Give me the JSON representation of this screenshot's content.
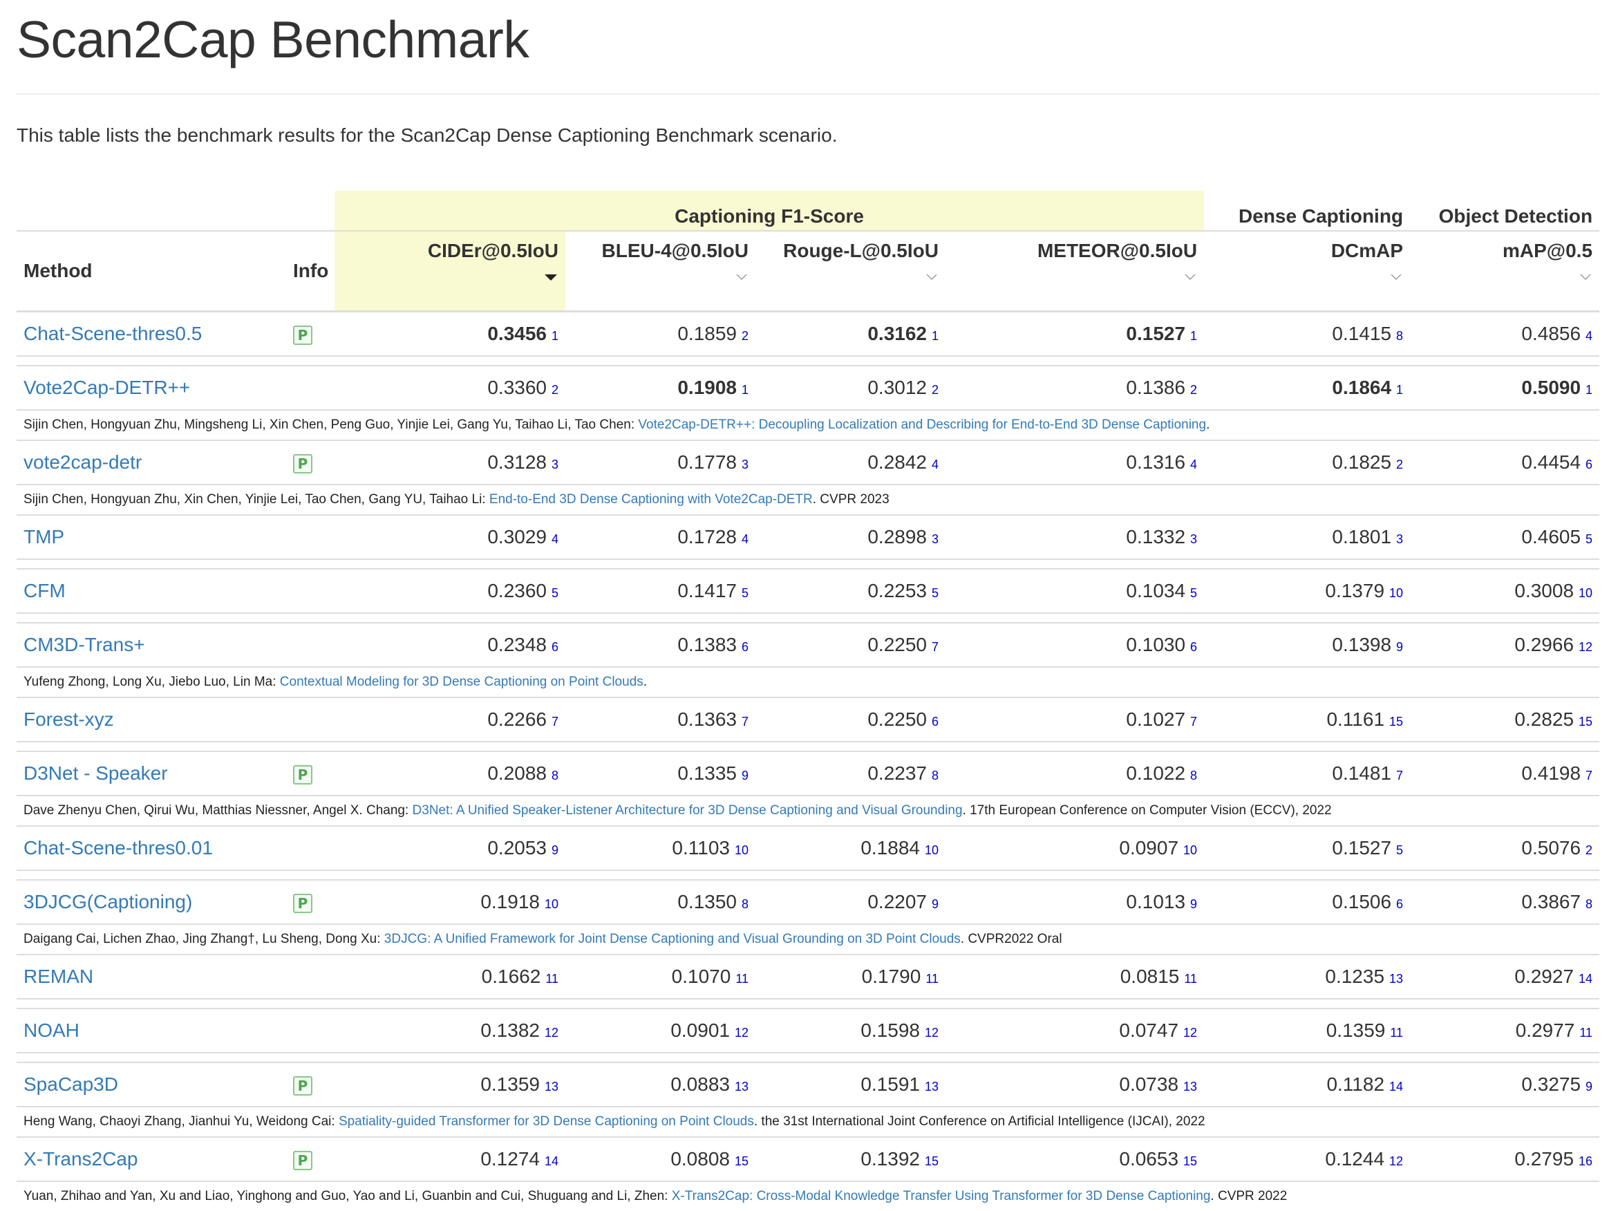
{
  "page": {
    "title": "Scan2Cap Benchmark",
    "intro": "This table lists the benchmark results for the Scan2Cap Dense Captioning Benchmark scenario."
  },
  "table": {
    "group_headers": {
      "captioning": "Captioning F1-Score",
      "dense": "Dense Captioning",
      "detection": "Object Detection"
    },
    "column_headers": {
      "method": "Method",
      "info": "Info",
      "cider": "CIDEr@0.5IoU",
      "bleu": "BLEU-4@0.5IoU",
      "rouge": "Rouge-L@0.5IoU",
      "meteor": "METEOR@0.5IoU",
      "dcmap": "DCmAP",
      "map": "mAP@0.5"
    },
    "sort": {
      "active_column": "cider",
      "direction": "descending"
    },
    "info_badge": "P",
    "rows": [
      {
        "method": "Chat-Scene-thres0.5",
        "info": "P",
        "cider": {
          "v": "0.3456",
          "r": "1",
          "best": true
        },
        "bleu": {
          "v": "0.1859",
          "r": "2",
          "best": false
        },
        "rouge": {
          "v": "0.3162",
          "r": "1",
          "best": true
        },
        "meteor": {
          "v": "0.1527",
          "r": "1",
          "best": true
        },
        "dcmap": {
          "v": "0.1415",
          "r": "8",
          "best": false
        },
        "map": {
          "v": "0.4856",
          "r": "4",
          "best": false
        },
        "cite": null
      },
      {
        "method": "Vote2Cap-DETR++",
        "info": "",
        "cider": {
          "v": "0.3360",
          "r": "2",
          "best": false
        },
        "bleu": {
          "v": "0.1908",
          "r": "1",
          "best": true
        },
        "rouge": {
          "v": "0.3012",
          "r": "2",
          "best": false
        },
        "meteor": {
          "v": "0.1386",
          "r": "2",
          "best": false
        },
        "dcmap": {
          "v": "0.1864",
          "r": "1",
          "best": true
        },
        "map": {
          "v": "0.5090",
          "r": "1",
          "best": true
        },
        "cite": {
          "authors": "Sijin Chen, Hongyuan Zhu, Mingsheng Li, Xin Chen, Peng Guo, Yinjie Lei, Gang Yu, Taihao Li, Tao Chen: ",
          "link": "Vote2Cap-DETR++: Decoupling Localization and Describing for End-to-End 3D Dense Captioning",
          "venue": "."
        }
      },
      {
        "method": "vote2cap-detr",
        "info": "P",
        "cider": {
          "v": "0.3128",
          "r": "3",
          "best": false
        },
        "bleu": {
          "v": "0.1778",
          "r": "3",
          "best": false
        },
        "rouge": {
          "v": "0.2842",
          "r": "4",
          "best": false
        },
        "meteor": {
          "v": "0.1316",
          "r": "4",
          "best": false
        },
        "dcmap": {
          "v": "0.1825",
          "r": "2",
          "best": false
        },
        "map": {
          "v": "0.4454",
          "r": "6",
          "best": false
        },
        "cite": {
          "authors": "Sijin Chen, Hongyuan Zhu, Xin Chen, Yinjie Lei, Tao Chen, Gang YU, Taihao Li: ",
          "link": "End-to-End 3D Dense Captioning with Vote2Cap-DETR",
          "venue": ". CVPR 2023"
        }
      },
      {
        "method": "TMP",
        "info": "",
        "cider": {
          "v": "0.3029",
          "r": "4",
          "best": false
        },
        "bleu": {
          "v": "0.1728",
          "r": "4",
          "best": false
        },
        "rouge": {
          "v": "0.2898",
          "r": "3",
          "best": false
        },
        "meteor": {
          "v": "0.1332",
          "r": "3",
          "best": false
        },
        "dcmap": {
          "v": "0.1801",
          "r": "3",
          "best": false
        },
        "map": {
          "v": "0.4605",
          "r": "5",
          "best": false
        },
        "cite": null
      },
      {
        "method": "CFM",
        "info": "",
        "cider": {
          "v": "0.2360",
          "r": "5",
          "best": false
        },
        "bleu": {
          "v": "0.1417",
          "r": "5",
          "best": false
        },
        "rouge": {
          "v": "0.2253",
          "r": "5",
          "best": false
        },
        "meteor": {
          "v": "0.1034",
          "r": "5",
          "best": false
        },
        "dcmap": {
          "v": "0.1379",
          "r": "10",
          "best": false
        },
        "map": {
          "v": "0.3008",
          "r": "10",
          "best": false
        },
        "cite": null
      },
      {
        "method": "CM3D-Trans+",
        "info": "",
        "cider": {
          "v": "0.2348",
          "r": "6",
          "best": false
        },
        "bleu": {
          "v": "0.1383",
          "r": "6",
          "best": false
        },
        "rouge": {
          "v": "0.2250",
          "r": "7",
          "best": false
        },
        "meteor": {
          "v": "0.1030",
          "r": "6",
          "best": false
        },
        "dcmap": {
          "v": "0.1398",
          "r": "9",
          "best": false
        },
        "map": {
          "v": "0.2966",
          "r": "12",
          "best": false
        },
        "cite": {
          "authors": "Yufeng Zhong, Long Xu, Jiebo Luo, Lin Ma: ",
          "link": "Contextual Modeling for 3D Dense Captioning on Point Clouds",
          "venue": "."
        }
      },
      {
        "method": "Forest-xyz",
        "info": "",
        "cider": {
          "v": "0.2266",
          "r": "7",
          "best": false
        },
        "bleu": {
          "v": "0.1363",
          "r": "7",
          "best": false
        },
        "rouge": {
          "v": "0.2250",
          "r": "6",
          "best": false
        },
        "meteor": {
          "v": "0.1027",
          "r": "7",
          "best": false
        },
        "dcmap": {
          "v": "0.1161",
          "r": "15",
          "best": false
        },
        "map": {
          "v": "0.2825",
          "r": "15",
          "best": false
        },
        "cite": null
      },
      {
        "method": "D3Net - Speaker",
        "info": "P",
        "cider": {
          "v": "0.2088",
          "r": "8",
          "best": false
        },
        "bleu": {
          "v": "0.1335",
          "r": "9",
          "best": false
        },
        "rouge": {
          "v": "0.2237",
          "r": "8",
          "best": false
        },
        "meteor": {
          "v": "0.1022",
          "r": "8",
          "best": false
        },
        "dcmap": {
          "v": "0.1481",
          "r": "7",
          "best": false
        },
        "map": {
          "v": "0.4198",
          "r": "7",
          "best": false
        },
        "cite": {
          "authors": "Dave Zhenyu Chen, Qirui Wu, Matthias Niessner, Angel X. Chang: ",
          "link": "D3Net: A Unified Speaker-Listener Architecture for 3D Dense Captioning and Visual Grounding",
          "venue": ". 17th European Conference on Computer Vision (ECCV), 2022"
        }
      },
      {
        "method": "Chat-Scene-thres0.01",
        "info": "",
        "cider": {
          "v": "0.2053",
          "r": "9",
          "best": false
        },
        "bleu": {
          "v": "0.1103",
          "r": "10",
          "best": false
        },
        "rouge": {
          "v": "0.1884",
          "r": "10",
          "best": false
        },
        "meteor": {
          "v": "0.0907",
          "r": "10",
          "best": false
        },
        "dcmap": {
          "v": "0.1527",
          "r": "5",
          "best": false
        },
        "map": {
          "v": "0.5076",
          "r": "2",
          "best": false
        },
        "cite": null
      },
      {
        "method": "3DJCG(Captioning)",
        "info": "P",
        "cider": {
          "v": "0.1918",
          "r": "10",
          "best": false
        },
        "bleu": {
          "v": "0.1350",
          "r": "8",
          "best": false
        },
        "rouge": {
          "v": "0.2207",
          "r": "9",
          "best": false
        },
        "meteor": {
          "v": "0.1013",
          "r": "9",
          "best": false
        },
        "dcmap": {
          "v": "0.1506",
          "r": "6",
          "best": false
        },
        "map": {
          "v": "0.3867",
          "r": "8",
          "best": false
        },
        "cite": {
          "authors": "Daigang Cai, Lichen Zhao, Jing Zhang†, Lu Sheng, Dong Xu: ",
          "link": "3DJCG: A Unified Framework for Joint Dense Captioning and Visual Grounding on 3D Point Clouds",
          "venue": ". CVPR2022 Oral"
        }
      },
      {
        "method": "REMAN",
        "info": "",
        "cider": {
          "v": "0.1662",
          "r": "11",
          "best": false
        },
        "bleu": {
          "v": "0.1070",
          "r": "11",
          "best": false
        },
        "rouge": {
          "v": "0.1790",
          "r": "11",
          "best": false
        },
        "meteor": {
          "v": "0.0815",
          "r": "11",
          "best": false
        },
        "dcmap": {
          "v": "0.1235",
          "r": "13",
          "best": false
        },
        "map": {
          "v": "0.2927",
          "r": "14",
          "best": false
        },
        "cite": null
      },
      {
        "method": "NOAH",
        "info": "",
        "cider": {
          "v": "0.1382",
          "r": "12",
          "best": false
        },
        "bleu": {
          "v": "0.0901",
          "r": "12",
          "best": false
        },
        "rouge": {
          "v": "0.1598",
          "r": "12",
          "best": false
        },
        "meteor": {
          "v": "0.0747",
          "r": "12",
          "best": false
        },
        "dcmap": {
          "v": "0.1359",
          "r": "11",
          "best": false
        },
        "map": {
          "v": "0.2977",
          "r": "11",
          "best": false
        },
        "cite": null
      },
      {
        "method": "SpaCap3D",
        "info": "P",
        "cider": {
          "v": "0.1359",
          "r": "13",
          "best": false
        },
        "bleu": {
          "v": "0.0883",
          "r": "13",
          "best": false
        },
        "rouge": {
          "v": "0.1591",
          "r": "13",
          "best": false
        },
        "meteor": {
          "v": "0.0738",
          "r": "13",
          "best": false
        },
        "dcmap": {
          "v": "0.1182",
          "r": "14",
          "best": false
        },
        "map": {
          "v": "0.3275",
          "r": "9",
          "best": false
        },
        "cite": {
          "authors": "Heng Wang, Chaoyi Zhang, Jianhui Yu, Weidong Cai: ",
          "link": "Spatiality-guided Transformer for 3D Dense Captioning on Point Clouds",
          "venue": ". the 31st International Joint Conference on Artificial Intelligence (IJCAI), 2022"
        }
      },
      {
        "method": "X-Trans2Cap",
        "info": "P",
        "cider": {
          "v": "0.1274",
          "r": "14",
          "best": false
        },
        "bleu": {
          "v": "0.0808",
          "r": "15",
          "best": false
        },
        "rouge": {
          "v": "0.1392",
          "r": "15",
          "best": false
        },
        "meteor": {
          "v": "0.0653",
          "r": "15",
          "best": false
        },
        "dcmap": {
          "v": "0.1244",
          "r": "12",
          "best": false
        },
        "map": {
          "v": "0.2795",
          "r": "16",
          "best": false
        },
        "cite": {
          "authors": "Yuan, Zhihao and Yan, Xu and Liao, Yinghong and Guo, Yao and Li, Guanbin and Cui, Shuguang and Li, Zhen: ",
          "link": "X-Trans2Cap: Cross-Modal Knowledge Transfer Using Transformer for 3D Dense Captioning",
          "venue": ". CVPR 2022"
        }
      }
    ]
  }
}
